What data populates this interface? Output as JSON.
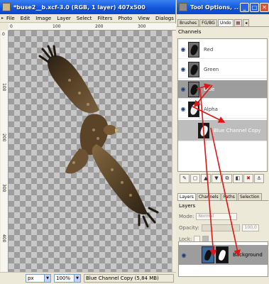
{
  "image_window": {
    "title": "*buse2__b.xcf-3.0 (RGB, 1 layer) 407x500",
    "menu": [
      "File",
      "Edit",
      "Image",
      "Layer",
      "Select",
      "Filters",
      "Photo",
      "View",
      "Dialogs"
    ],
    "ruler_labels": [
      "0",
      "100",
      "200",
      "300"
    ],
    "vruler_labels": [
      "0",
      "100",
      "200",
      "300",
      "400"
    ],
    "status": {
      "unit": "px",
      "zoom": "100%",
      "message": "Blue Channel Copy (5,84 MB)"
    }
  },
  "dock_window": {
    "title": "Tool Options, ...",
    "top_tabs": [
      "Brushes",
      "FG/BG",
      "Undo"
    ],
    "channels_title": "Channels",
    "channels": [
      {
        "name": "Red",
        "tone": "light",
        "visible": true
      },
      {
        "name": "Green",
        "tone": "light",
        "visible": true
      },
      {
        "name": "Blue",
        "tone": "light",
        "visible": true,
        "selected": true
      },
      {
        "name": "Alpha",
        "tone": "dark",
        "visible": true
      },
      {
        "name": "Blue Channel Copy",
        "tone": "dark",
        "visible": false
      }
    ],
    "bottom_tabs": [
      "Layers",
      "Channels",
      "Paths",
      "Selection"
    ],
    "layers_title": "Layers",
    "mode_label": "Mode:",
    "mode_value": "Normal",
    "opacity_label": "Opacity:",
    "opacity_value": "100,0",
    "lock_label": "Lock:",
    "layer_name": "Background"
  },
  "colors": {
    "titlebar": "#0f55d9",
    "annotation_arrow": "#e01414",
    "selected_row": "#9d9d9d"
  }
}
